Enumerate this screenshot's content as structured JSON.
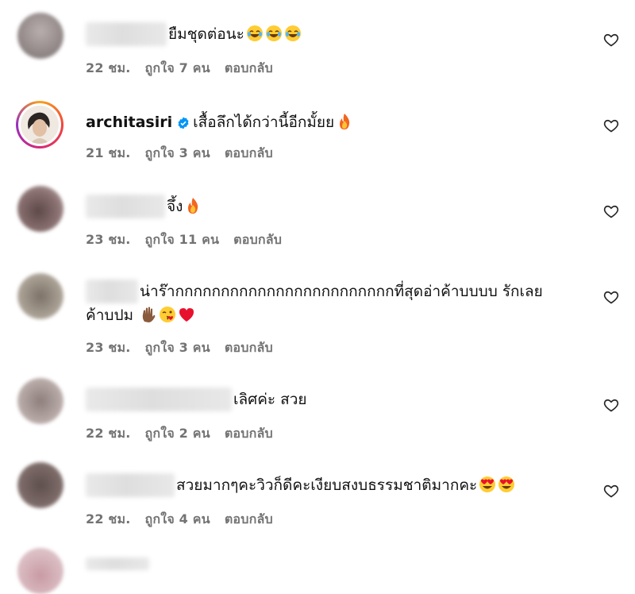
{
  "comments": [
    {
      "text": "ยืมชุดต่อนะ",
      "emojis": [
        "laugh-cry",
        "laugh-cry",
        "laugh-cry"
      ],
      "time": "22 ชม.",
      "likes": "ถูกใจ 7 คน",
      "reply": "ตอบกลับ"
    },
    {
      "username": "architasiri",
      "verified": true,
      "text": "เสื้อลึกได้กว่านี้อีกมั้ยย",
      "emojis": [
        "fire"
      ],
      "time": "21 ชม.",
      "likes": "ถูกใจ 3 คน",
      "reply": "ตอบกลับ"
    },
    {
      "text": "จึ้ง",
      "emojis": [
        "fire"
      ],
      "time": "23 ชม.",
      "likes": "ถูกใจ 11 คน",
      "reply": "ตอบกลับ"
    },
    {
      "text": "น่าร๊ากกกกกกกกกกกกกกกกกกกกกกกกที่สุดอ่าค้าบบบบ รักเลย",
      "text2": "ค้าบปม",
      "emojis": [
        "hand",
        "kiss",
        "heart"
      ],
      "time": "23 ชม.",
      "likes": "ถูกใจ 3 คน",
      "reply": "ตอบกลับ"
    },
    {
      "text": "เลิศค่ะ สวย",
      "emojis": [],
      "time": "22 ชม.",
      "likes": "ถูกใจ 2 คน",
      "reply": "ตอบกลับ"
    },
    {
      "text": "สวยมากๆคะวิวก็ดีคะเงียบสงบธรรมชาติมากคะ",
      "emojis": [
        "heart-eyes",
        "heart-eyes"
      ],
      "time": "22 ชม.",
      "likes": "ถูกใจ 4 คน",
      "reply": "ตอบกลับ"
    }
  ],
  "colors": {
    "meta": "#737373",
    "verified": "#0095f6",
    "heart": "#262626"
  }
}
